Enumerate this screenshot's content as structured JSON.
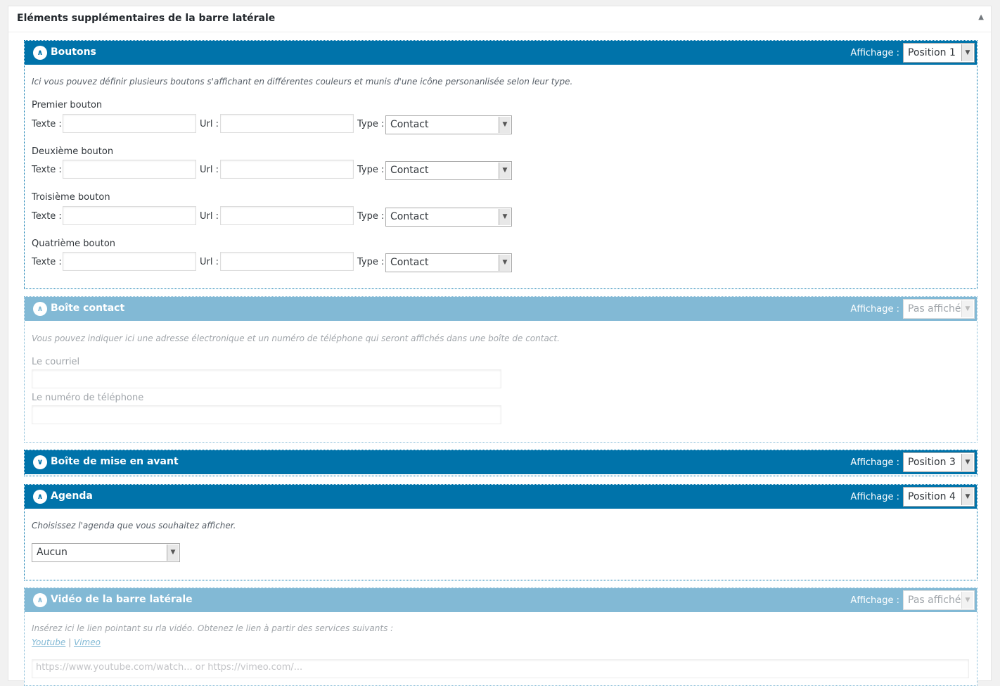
{
  "metabox": {
    "title": "Eléments supplémentaires de la barre latérale",
    "toggle_icon": "triangle-up-icon"
  },
  "affichage_label": "Affichage :",
  "sections": {
    "boutons": {
      "icon": "chevron-up-icon",
      "title": "Boutons",
      "affichage": "Position 1",
      "description": "Ici vous pouvez définir plusieurs boutons s'affichant en différentes couleurs et munis d'une icône personanlisée selon leur type.",
      "text_label": "Texte :",
      "url_label": "Url :",
      "type_label": "Type :",
      "buttons": [
        {
          "label": "Premier bouton",
          "texte": "",
          "url": "",
          "type": "Contact"
        },
        {
          "label": "Deuxième bouton",
          "texte": "",
          "url": "",
          "type": "Contact"
        },
        {
          "label": "Troisième bouton",
          "texte": "",
          "url": "",
          "type": "Contact"
        },
        {
          "label": "Quatrième bouton",
          "texte": "",
          "url": "",
          "type": "Contact"
        }
      ]
    },
    "contact": {
      "icon": "chevron-up-icon",
      "title": "Boîte contact",
      "affichage": "Pas affiché",
      "description": "Vous pouvez indiquer ici une adresse électronique et un numéro de téléphone qui seront affichés dans une boîte de contact.",
      "email_label": "Le courriel",
      "email_value": "",
      "phone_label": "Le numéro de téléphone",
      "phone_value": ""
    },
    "mise_en_avant": {
      "icon": "chevron-down-icon",
      "title": "Boîte de mise en avant",
      "affichage": "Position 3"
    },
    "agenda": {
      "icon": "chevron-up-icon",
      "title": "Agenda",
      "affichage": "Position 4",
      "description": "Choisissez l'agenda que vous souhaitez afficher.",
      "selected": "Aucun"
    },
    "video": {
      "icon": "chevron-up-icon",
      "title": "Vidéo de la barre latérale",
      "affichage": "Pas affiché",
      "description": "Insérez ici le lien pointant su rla vidéo. Obtenez le lien à partir des services suivants :",
      "link_youtube": "Youtube",
      "separator": "|",
      "link_vimeo": "Vimeo",
      "url_placeholder": "https://www.youtube.com/watch... or https://vimeo.com/..."
    }
  }
}
